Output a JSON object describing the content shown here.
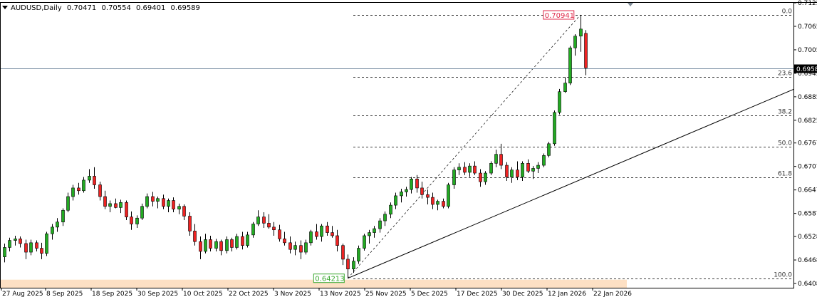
{
  "title_bar": {
    "symbol": "AUDUSD",
    "timeframe": ",Daily",
    "open": "0.70471",
    "high": "0.70554",
    "low": "0.69401",
    "close": "0.69589"
  },
  "colors": {
    "bull": "#22aa22",
    "bear": "#ee2222",
    "wick": "#000000",
    "fib": "#000000",
    "price_line": "#7a8fa3",
    "high_tag": "#e0294a",
    "low_tag": "#3aa830",
    "low_band": "#fde0c4"
  },
  "chart_data": {
    "type": "candlestick",
    "symbol": "AUDUSD",
    "timeframe": "Daily",
    "ylim": [
      0.6408,
      0.7125
    ],
    "y_ticks": [
      "0.7125",
      "0.7065",
      "0.7005",
      "0.6945",
      "0.6885",
      "0.6825",
      "0.6767",
      "0.6707",
      "0.6647",
      "0.6587",
      "0.6528",
      "0.6468",
      "0.6408"
    ],
    "x_labels": [
      "27 Aug 2025",
      "8 Sep 2025",
      "18 Sep 2025",
      "30 Sep 2025",
      "10 Oct 2025",
      "22 Oct 2025",
      "3 Nov 2025",
      "13 Nov 2025",
      "25 Nov 2025",
      "5 Dec 2025",
      "17 Dec 2025",
      "30 Dec 2025",
      "12 Jan 2026",
      "22 Jan 2026"
    ],
    "current_price": "0.6958",
    "fibonacci": {
      "high": 0.70941,
      "low": 0.64213,
      "levels": [
        {
          "label": "0.0",
          "value": 0.70941
        },
        {
          "label": "23.6",
          "value": 0.69353
        },
        {
          "label": "38.2",
          "value": 0.68371
        },
        {
          "label": "50.0",
          "value": 0.67577
        },
        {
          "label": "61.8",
          "value": 0.66783
        },
        {
          "label": "100.0",
          "value": 0.64213
        }
      ]
    },
    "high_label": "0.70941",
    "low_label": "0.64213",
    "trendline": {
      "from": [
        0.64213,
        0.64213
      ],
      "to_value": 0.6904
    },
    "candles": [
      [
        0.6476,
        0.651,
        0.6462,
        0.65
      ],
      [
        0.65,
        0.6525,
        0.649,
        0.6518
      ],
      [
        0.6518,
        0.653,
        0.6505,
        0.6522
      ],
      [
        0.6522,
        0.6528,
        0.65,
        0.651
      ],
      [
        0.651,
        0.652,
        0.647,
        0.6488
      ],
      [
        0.6488,
        0.652,
        0.648,
        0.6512
      ],
      [
        0.6512,
        0.6518,
        0.649,
        0.6498
      ],
      [
        0.6498,
        0.6512,
        0.647,
        0.6485
      ],
      [
        0.6485,
        0.654,
        0.6478,
        0.6535
      ],
      [
        0.6535,
        0.656,
        0.652,
        0.6552
      ],
      [
        0.6552,
        0.6575,
        0.654,
        0.6565
      ],
      [
        0.6565,
        0.66,
        0.6555,
        0.6595
      ],
      [
        0.6595,
        0.664,
        0.659,
        0.663
      ],
      [
        0.663,
        0.666,
        0.662,
        0.6652
      ],
      [
        0.6652,
        0.6665,
        0.6635,
        0.6645
      ],
      [
        0.6645,
        0.668,
        0.664,
        0.6672
      ],
      [
        0.6672,
        0.67,
        0.6665,
        0.6682
      ],
      [
        0.6682,
        0.6705,
        0.665,
        0.666
      ],
      [
        0.666,
        0.6668,
        0.662,
        0.663
      ],
      [
        0.663,
        0.6645,
        0.6598,
        0.6605
      ],
      [
        0.6605,
        0.662,
        0.659,
        0.6612
      ],
      [
        0.6612,
        0.6625,
        0.66,
        0.6602
      ],
      [
        0.6602,
        0.6622,
        0.6588,
        0.6615
      ],
      [
        0.6615,
        0.662,
        0.657,
        0.6578
      ],
      [
        0.6578,
        0.6592,
        0.6545,
        0.656
      ],
      [
        0.656,
        0.6582,
        0.655,
        0.6575
      ],
      [
        0.6575,
        0.6612,
        0.657,
        0.6605
      ],
      [
        0.6605,
        0.6638,
        0.66,
        0.663
      ],
      [
        0.663,
        0.6642,
        0.6605,
        0.6618
      ],
      [
        0.6618,
        0.663,
        0.66,
        0.6625
      ],
      [
        0.6625,
        0.6635,
        0.6598,
        0.6605
      ],
      [
        0.6605,
        0.6625,
        0.659,
        0.662
      ],
      [
        0.662,
        0.6628,
        0.659,
        0.6598
      ],
      [
        0.6598,
        0.6612,
        0.6585,
        0.6605
      ],
      [
        0.6605,
        0.661,
        0.657,
        0.658
      ],
      [
        0.658,
        0.659,
        0.653,
        0.6542
      ],
      [
        0.6542,
        0.656,
        0.6505,
        0.6515
      ],
      [
        0.6515,
        0.6528,
        0.647,
        0.649
      ],
      [
        0.649,
        0.6535,
        0.6485,
        0.652
      ],
      [
        0.652,
        0.653,
        0.649,
        0.6498
      ],
      [
        0.6498,
        0.6522,
        0.649,
        0.6515
      ],
      [
        0.6515,
        0.652,
        0.648,
        0.6492
      ],
      [
        0.6492,
        0.6528,
        0.6485,
        0.652
      ],
      [
        0.652,
        0.6525,
        0.649,
        0.65
      ],
      [
        0.65,
        0.6535,
        0.6495,
        0.6528
      ],
      [
        0.6528,
        0.654,
        0.6495,
        0.6505
      ],
      [
        0.6505,
        0.654,
        0.65,
        0.6532
      ],
      [
        0.6532,
        0.6565,
        0.6525,
        0.656
      ],
      [
        0.656,
        0.6595,
        0.6555,
        0.6578
      ],
      [
        0.6578,
        0.659,
        0.655,
        0.6562
      ],
      [
        0.6562,
        0.6585,
        0.6548,
        0.6552
      ],
      [
        0.6552,
        0.6565,
        0.653,
        0.6545
      ],
      [
        0.6545,
        0.6558,
        0.6515,
        0.6522
      ],
      [
        0.6522,
        0.654,
        0.6505,
        0.6512
      ],
      [
        0.6512,
        0.6528,
        0.6485,
        0.6495
      ],
      [
        0.6495,
        0.6515,
        0.648,
        0.6505
      ],
      [
        0.6505,
        0.6518,
        0.647,
        0.6488
      ],
      [
        0.6488,
        0.652,
        0.6482,
        0.6512
      ],
      [
        0.6512,
        0.6545,
        0.6505,
        0.654
      ],
      [
        0.654,
        0.656,
        0.652,
        0.6528
      ],
      [
        0.6528,
        0.656,
        0.6515,
        0.6555
      ],
      [
        0.6555,
        0.6565,
        0.653,
        0.6538
      ],
      [
        0.6538,
        0.6555,
        0.6525,
        0.653
      ],
      [
        0.653,
        0.6545,
        0.649,
        0.6505
      ],
      [
        0.6505,
        0.651,
        0.6455,
        0.647
      ],
      [
        0.647,
        0.6482,
        0.6421,
        0.6445
      ],
      [
        0.6445,
        0.6475,
        0.6435,
        0.6465
      ],
      [
        0.6465,
        0.6505,
        0.6458,
        0.6498
      ],
      [
        0.6498,
        0.6535,
        0.6492,
        0.653
      ],
      [
        0.653,
        0.6545,
        0.651,
        0.6538
      ],
      [
        0.6538,
        0.6555,
        0.6525,
        0.6548
      ],
      [
        0.6548,
        0.6575,
        0.6538,
        0.6568
      ],
      [
        0.6568,
        0.6592,
        0.6555,
        0.6585
      ],
      [
        0.6585,
        0.6615,
        0.6575,
        0.6608
      ],
      [
        0.6608,
        0.664,
        0.6598,
        0.6632
      ],
      [
        0.6632,
        0.665,
        0.6615,
        0.6642
      ],
      [
        0.6642,
        0.6655,
        0.663,
        0.6648
      ],
      [
        0.6648,
        0.668,
        0.6638,
        0.6675
      ],
      [
        0.6675,
        0.6685,
        0.664,
        0.6652
      ],
      [
        0.6652,
        0.6668,
        0.6625,
        0.6635
      ],
      [
        0.6635,
        0.6648,
        0.661,
        0.6628
      ],
      [
        0.6628,
        0.664,
        0.6598,
        0.661
      ],
      [
        0.661,
        0.6622,
        0.6595,
        0.6618
      ],
      [
        0.6618,
        0.6625,
        0.66,
        0.6605
      ],
      [
        0.6605,
        0.6665,
        0.66,
        0.666
      ],
      [
        0.666,
        0.6705,
        0.665,
        0.6698
      ],
      [
        0.6698,
        0.6715,
        0.6685,
        0.6705
      ],
      [
        0.6705,
        0.6718,
        0.6685,
        0.6692
      ],
      [
        0.6692,
        0.6715,
        0.668,
        0.6708
      ],
      [
        0.6708,
        0.672,
        0.6685,
        0.669
      ],
      [
        0.669,
        0.67,
        0.6655,
        0.6668
      ],
      [
        0.6668,
        0.6695,
        0.666,
        0.669
      ],
      [
        0.669,
        0.672,
        0.6685,
        0.6715
      ],
      [
        0.6715,
        0.675,
        0.6705,
        0.6738
      ],
      [
        0.6738,
        0.6765,
        0.67,
        0.671
      ],
      [
        0.671,
        0.6718,
        0.667,
        0.668
      ],
      [
        0.668,
        0.6705,
        0.6665,
        0.6698
      ],
      [
        0.6698,
        0.672,
        0.6672,
        0.668
      ],
      [
        0.668,
        0.672,
        0.667,
        0.6715
      ],
      [
        0.6715,
        0.6725,
        0.669,
        0.6695
      ],
      [
        0.6695,
        0.6708,
        0.6675,
        0.6702
      ],
      [
        0.6702,
        0.6718,
        0.669,
        0.671
      ],
      [
        0.671,
        0.674,
        0.6705,
        0.6735
      ],
      [
        0.6735,
        0.677,
        0.673,
        0.6765
      ],
      [
        0.6765,
        0.685,
        0.676,
        0.6845
      ],
      [
        0.6845,
        0.6905,
        0.684,
        0.6898
      ],
      [
        0.6898,
        0.6935,
        0.6895,
        0.692
      ],
      [
        0.692,
        0.7015,
        0.6915,
        0.701
      ],
      [
        0.701,
        0.7045,
        0.699,
        0.704
      ],
      [
        0.704,
        0.70941,
        0.7,
        0.7058
      ],
      [
        0.70471,
        0.70554,
        0.69401,
        0.69589
      ]
    ]
  }
}
